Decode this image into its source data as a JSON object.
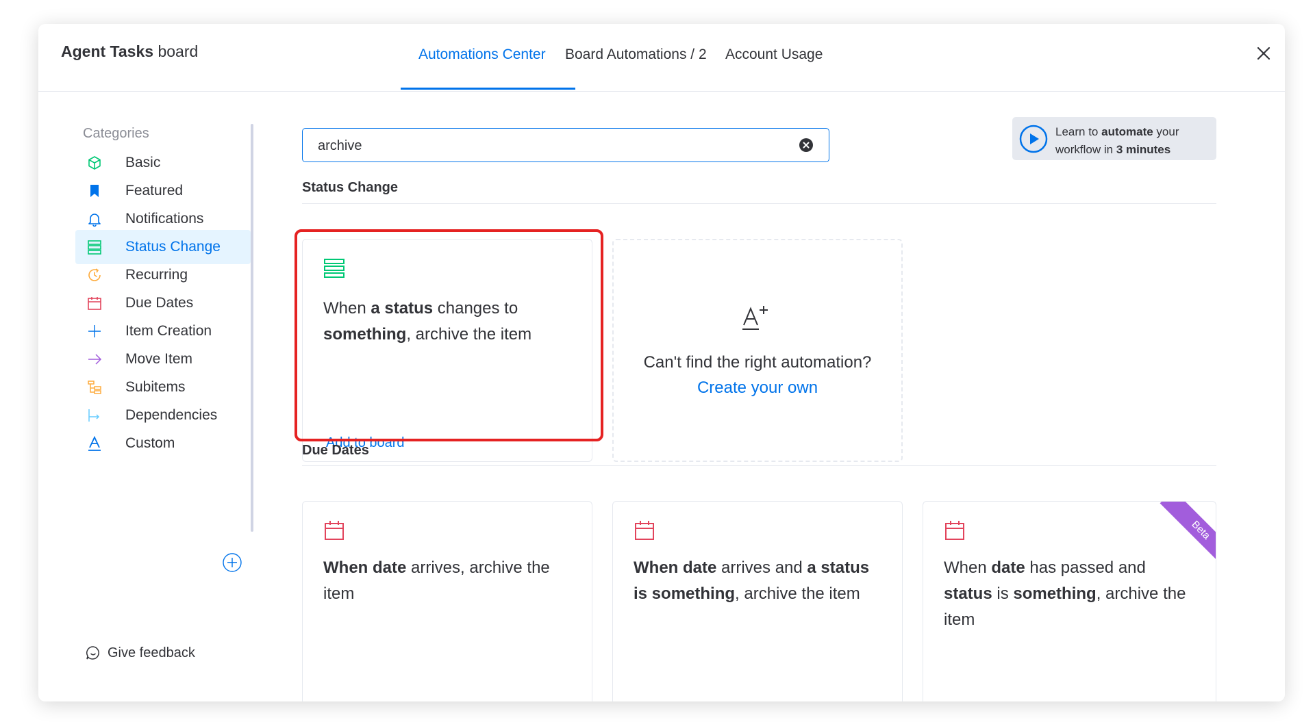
{
  "header": {
    "board_name": "Agent Tasks",
    "board_suffix": "board",
    "tabs": [
      {
        "label": "Automations Center"
      },
      {
        "label": "Board Automations / 2"
      },
      {
        "label": "Account Usage"
      }
    ],
    "close_icon": "close-icon"
  },
  "sidebar": {
    "title": "Categories",
    "items": [
      {
        "label": "Basic",
        "icon": "cube-icon",
        "color": "#00c875"
      },
      {
        "label": "Featured",
        "icon": "bookmark-icon",
        "color": "#0073ea"
      },
      {
        "label": "Notifications",
        "icon": "bell-icon",
        "color": "#0073ea"
      },
      {
        "label": "Status Change",
        "icon": "status-list-icon",
        "color": "#00c875"
      },
      {
        "label": "Recurring",
        "icon": "recurring-clock-icon",
        "color": "#fdab3d"
      },
      {
        "label": "Due Dates",
        "icon": "calendar-icon",
        "color": "#e2445c"
      },
      {
        "label": "Item Creation",
        "icon": "plus-icon",
        "color": "#0073ea"
      },
      {
        "label": "Move Item",
        "icon": "arrow-right-icon",
        "color": "#a25ddc"
      },
      {
        "label": "Subitems",
        "icon": "subitems-icon",
        "color": "#fdab3d"
      },
      {
        "label": "Dependencies",
        "icon": "dependencies-icon",
        "color": "#66ccff"
      },
      {
        "label": "Custom",
        "icon": "custom-a-icon",
        "color": "#0073ea"
      }
    ],
    "feedback_label": "Give feedback"
  },
  "search": {
    "value": "archive",
    "placeholder": ""
  },
  "learn": {
    "line1_pre": "Learn to ",
    "line1_bold": "automate",
    "line1_post": " your",
    "line2_pre": "workflow in ",
    "line2_bold": "3 minutes"
  },
  "status_change": {
    "title": "Status Change",
    "card": {
      "t1": "When ",
      "b1": "a status",
      "t2": " changes to ",
      "b2": "something",
      "t3": ", archive the item",
      "add_label": "Add to board"
    },
    "own": {
      "question": "Can't find the right automation?",
      "link": "Create your own"
    }
  },
  "due_dates": {
    "title": "Due Dates",
    "cards": [
      {
        "b1": "When date",
        "t1": " arrives, archive the item"
      },
      {
        "b1": "When date",
        "t1": " arrives and ",
        "b2": "a status is something",
        "t2": ", archive the item"
      },
      {
        "t0": "When ",
        "b1": "date",
        "t1": " has passed and ",
        "b2": "status",
        "t2": " is ",
        "b3": "something",
        "t3": ", archive the item",
        "badge": "Beta"
      }
    ]
  },
  "colors": {
    "accent": "#0073ea",
    "highlight": "#e52222",
    "beta": "#a25ddc"
  }
}
